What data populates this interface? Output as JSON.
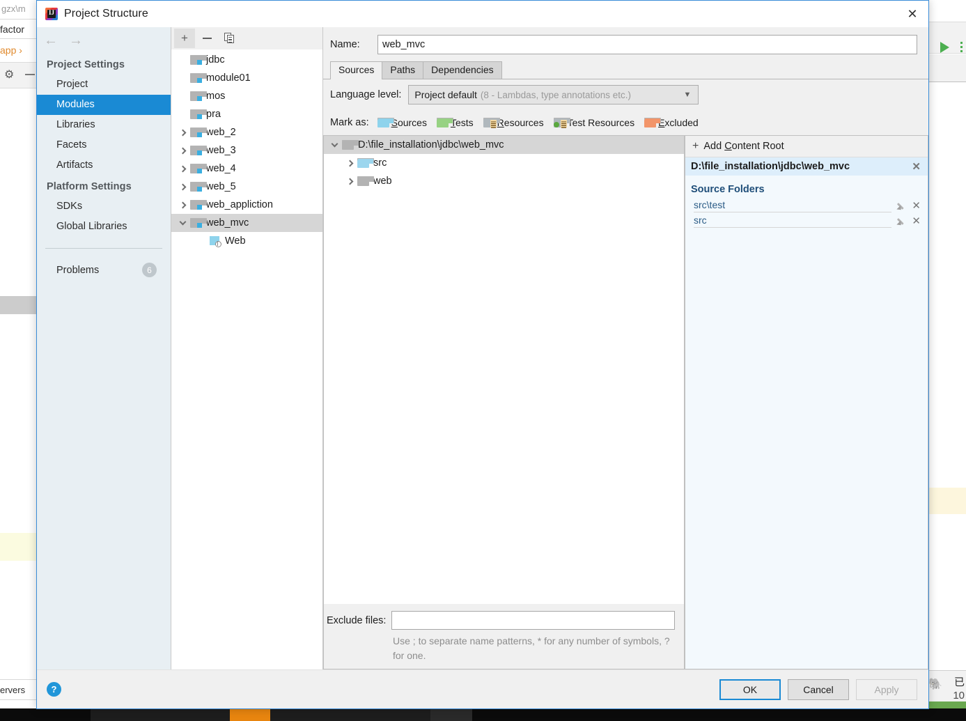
{
  "background": {
    "breadcrumb_text": "gzx\\m",
    "row2_text": "factor",
    "row3_text": "app ›",
    "gear_icon": "gear-icon",
    "servers_text": "ervers",
    "run_icon": "run-triangle-icon",
    "elephant_icon": "evernote-elephant-icon",
    "cn_text_1": "已",
    "cn_text_2": "10",
    "status_text": ""
  },
  "dialog": {
    "title": "Project Structure",
    "title_icon": "intellij-idea-logo-icon",
    "close_label": "✕"
  },
  "sidebar": {
    "back_icon": "←",
    "forward_icon": "→",
    "sections": [
      {
        "header": "Project Settings",
        "items": [
          {
            "label": "Project",
            "selected": false
          },
          {
            "label": "Modules",
            "selected": true
          },
          {
            "label": "Libraries",
            "selected": false
          },
          {
            "label": "Facets",
            "selected": false
          },
          {
            "label": "Artifacts",
            "selected": false
          }
        ]
      },
      {
        "header": "Platform Settings",
        "items": [
          {
            "label": "SDKs",
            "selected": false
          },
          {
            "label": "Global Libraries",
            "selected": false
          }
        ]
      }
    ],
    "problems": {
      "label": "Problems",
      "count": "6"
    }
  },
  "module_toolbar": {
    "add_label": "+",
    "remove_label": "−",
    "copy_label": "copy-icon"
  },
  "module_tree": [
    {
      "label": "jdbc",
      "indent": 1,
      "twisty": "none",
      "icon": "module-folder-icon",
      "selected": false
    },
    {
      "label": "module01",
      "indent": 1,
      "twisty": "none",
      "icon": "module-folder-icon",
      "selected": false
    },
    {
      "label": "mos",
      "indent": 1,
      "twisty": "none",
      "icon": "module-folder-icon",
      "selected": false
    },
    {
      "label": "pra",
      "indent": 1,
      "twisty": "none",
      "icon": "module-folder-icon",
      "selected": false
    },
    {
      "label": "web_2",
      "indent": 1,
      "twisty": "collapsed",
      "icon": "module-folder-icon",
      "selected": false
    },
    {
      "label": "web_3",
      "indent": 1,
      "twisty": "collapsed",
      "icon": "module-folder-icon",
      "selected": false
    },
    {
      "label": "web_4",
      "indent": 1,
      "twisty": "collapsed",
      "icon": "module-folder-icon",
      "selected": false
    },
    {
      "label": "web_5",
      "indent": 1,
      "twisty": "collapsed",
      "icon": "module-folder-icon",
      "selected": false
    },
    {
      "label": "web_appliction",
      "indent": 1,
      "twisty": "collapsed",
      "icon": "module-folder-icon",
      "selected": false
    },
    {
      "label": "web_mvc",
      "indent": 1,
      "twisty": "expanded",
      "icon": "module-folder-icon",
      "selected": true
    },
    {
      "label": "Web",
      "indent": 2,
      "twisty": "none",
      "icon": "web-facet-icon",
      "selected": false
    }
  ],
  "detail": {
    "name_label": "Name:",
    "name_value": "web_mvc",
    "tabs": [
      {
        "label": "Sources",
        "active": true
      },
      {
        "label": "Paths",
        "active": false
      },
      {
        "label": "Dependencies",
        "active": false
      }
    ],
    "language_level": {
      "label": "Language level:",
      "value": "Project default",
      "hint": "(8 - Lambdas, type annotations etc.)",
      "arrow_icon": "chevron-down-icon"
    },
    "mark_as": {
      "label": "Mark as:",
      "options": [
        {
          "label": "Sources",
          "mnemonic": "S",
          "rest": "ources",
          "color": "blue"
        },
        {
          "label": "Tests",
          "mnemonic": "T",
          "rest": "ests",
          "color": "green"
        },
        {
          "label": "Resources",
          "mnemonic": "R",
          "rest": "esources",
          "color": "gray"
        },
        {
          "label": "Test Resources",
          "mnemonic": "",
          "rest": "Test Resources",
          "color": "testres"
        },
        {
          "label": "Excluded",
          "mnemonic": "E",
          "rest": "xcluded",
          "color": "orange"
        }
      ]
    },
    "roots_tree": [
      {
        "label": "D:\\file_installation\\jdbc\\web_mvc",
        "level": 1,
        "twisty": "expanded",
        "icon": "gray-folder-icon",
        "selected": true
      },
      {
        "label": "src",
        "level": 2,
        "twisty": "collapsed",
        "icon": "blue-folder-icon",
        "selected": false
      },
      {
        "label": "web",
        "level": 2,
        "twisty": "collapsed",
        "icon": "gray-folder-icon",
        "selected": false
      }
    ],
    "exclude": {
      "label": "Exclude files:",
      "value": "",
      "placeholder": "",
      "hint": "Use ; to separate name patterns, * for any number of symbols, ? for one."
    }
  },
  "source_panel": {
    "add_content_root": {
      "plus": "+",
      "pre": "Add ",
      "mnemonic": "C",
      "post": "ontent Root"
    },
    "content_root": {
      "path": "D:\\file_installation\\jdbc\\web_mvc",
      "remove_icon": "✕"
    },
    "source_folders_title": "Source Folders",
    "folders": [
      {
        "path": "src\\test",
        "edit_icon": "pencil-icon",
        "remove_icon": "✕"
      },
      {
        "path": "src",
        "edit_icon": "pencil-icon",
        "remove_icon": "✕"
      }
    ]
  },
  "footer": {
    "help_label": "?",
    "ok_label": "OK",
    "cancel_label": "Cancel",
    "apply_label": "Apply"
  },
  "colors": {
    "accent_blue": "#1a8ad4",
    "selection_gray": "#d6d6d6",
    "panel_bg": "#f0f0f0",
    "sidebar_bg": "#e8eff3",
    "source_panel_bg": "#f3f9fd",
    "root_header_bg": "#ddeefb",
    "source_title_blue": "#1f4e79"
  }
}
